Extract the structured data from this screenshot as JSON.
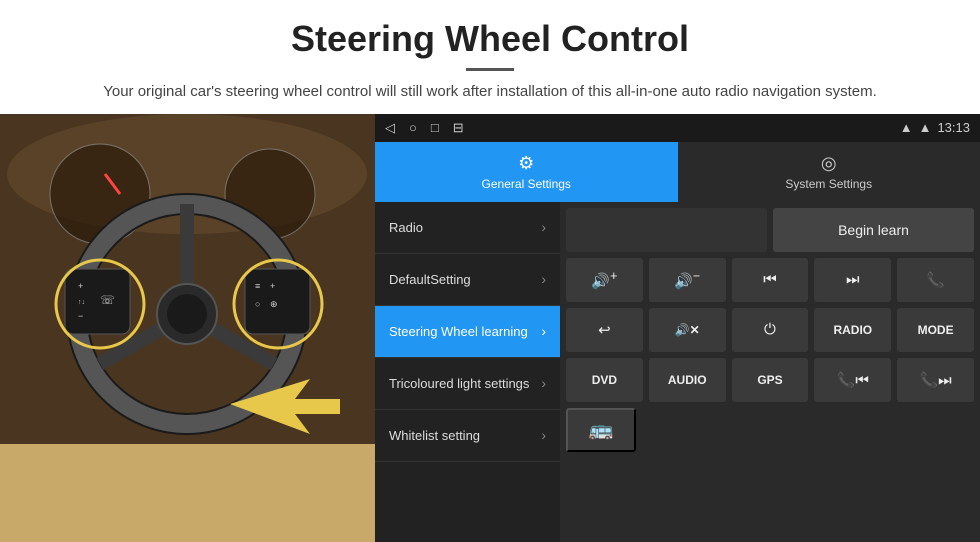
{
  "header": {
    "title": "Steering Wheel Control",
    "divider": true,
    "subtitle": "Your original car's steering wheel control will still work after installation of this all-in-one auto radio navigation system."
  },
  "status_bar": {
    "icons": [
      "◁",
      "○",
      "□",
      "⊟"
    ],
    "right_icons": [
      "▲",
      "▲"
    ],
    "time": "13:13"
  },
  "tabs": {
    "general": {
      "label": "General Settings",
      "icon": "⚙"
    },
    "system": {
      "label": "System Settings",
      "icon": "🌐"
    }
  },
  "menu": {
    "items": [
      {
        "label": "Radio",
        "active": false
      },
      {
        "label": "DefaultSetting",
        "active": false
      },
      {
        "label": "Steering Wheel learning",
        "active": true
      },
      {
        "label": "Tricoloured light settings",
        "active": false
      },
      {
        "label": "Whitelist setting",
        "active": false
      }
    ]
  },
  "control_panel": {
    "begin_learn_label": "Begin learn",
    "rows": [
      [
        {
          "type": "icon",
          "value": "🔊+",
          "label": "volume-up"
        },
        {
          "type": "icon",
          "value": "🔊-",
          "label": "volume-down"
        },
        {
          "type": "icon",
          "value": "⏮",
          "label": "prev-track"
        },
        {
          "type": "icon",
          "value": "⏭",
          "label": "next-track"
        },
        {
          "type": "icon",
          "value": "📞",
          "label": "phone"
        }
      ],
      [
        {
          "type": "icon",
          "value": "↩",
          "label": "hang-up"
        },
        {
          "type": "text",
          "value": "🔊x",
          "label": "mute"
        },
        {
          "type": "icon",
          "value": "⏻",
          "label": "power"
        },
        {
          "type": "text",
          "value": "RADIO",
          "label": "radio-btn"
        },
        {
          "type": "text",
          "value": "MODE",
          "label": "mode-btn"
        }
      ],
      [
        {
          "type": "text",
          "value": "DVD",
          "label": "dvd-btn"
        },
        {
          "type": "text",
          "value": "AUDIO",
          "label": "audio-btn"
        },
        {
          "type": "text",
          "value": "GPS",
          "label": "gps-btn"
        },
        {
          "type": "icon",
          "value": "📞⏮",
          "label": "phone-prev"
        },
        {
          "type": "icon",
          "value": "📞⏭",
          "label": "phone-next"
        }
      ]
    ],
    "bottom_row": {
      "icon": "🚌",
      "label": "bus-icon"
    }
  }
}
